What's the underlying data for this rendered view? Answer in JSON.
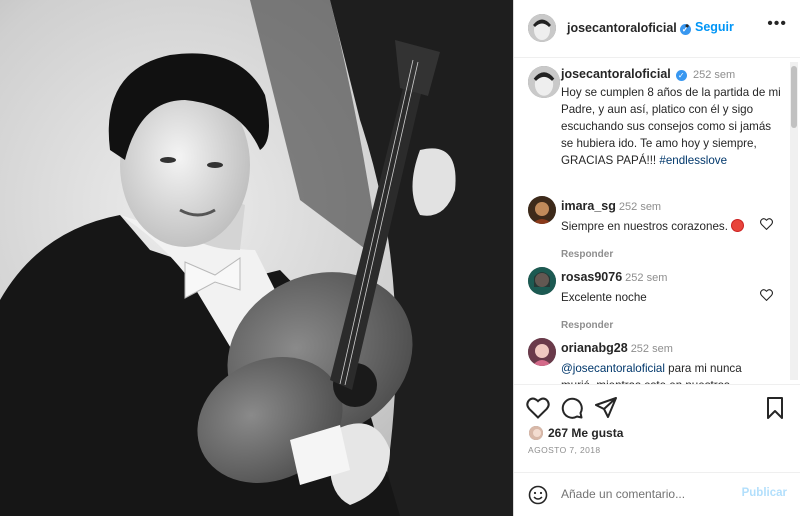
{
  "post": {
    "username": "josecantoraloficial",
    "follow_label": "Seguir",
    "more_label": "•••",
    "caption_time": "252 sem",
    "caption_text": "Hoy se cumplen 8 años de la partida de mi Padre, y aun así, platico con él y sigo escuchando sus consejos como si jamás se hubiera ido. Te amo hoy y siempre, GRACIAS PAPÁ!!!",
    "caption_hashtag": "#endlesslove",
    "likes": "267 Me gusta",
    "date": "AGOSTO 7, 2018"
  },
  "comments": [
    {
      "username": "imara_sg",
      "time": "252 sem",
      "text": "Siempre en nuestros corazones.",
      "reply": "Responder"
    },
    {
      "username": "rosas9076",
      "time": "252 sem",
      "text": "Excelente noche",
      "reply": "Responder"
    },
    {
      "username": "orianabg28",
      "time": "252 sem",
      "mention": "@josecantoraloficial",
      "text": "para mi nunca murió, mientras este en nuestros"
    }
  ],
  "composer": {
    "placeholder": "Añade un comentario...",
    "publish_label": "Publicar"
  },
  "icons": {
    "like": "heart-icon",
    "comment": "comment-icon",
    "share": "share-icon",
    "save": "bookmark-icon",
    "emoji": "emoji-icon",
    "verified": "verified-badge-icon"
  },
  "colors": {
    "accent": "#0095f6",
    "link": "#00376b",
    "muted": "#8e8e8e",
    "publish_disabled": "#b2dffc"
  }
}
